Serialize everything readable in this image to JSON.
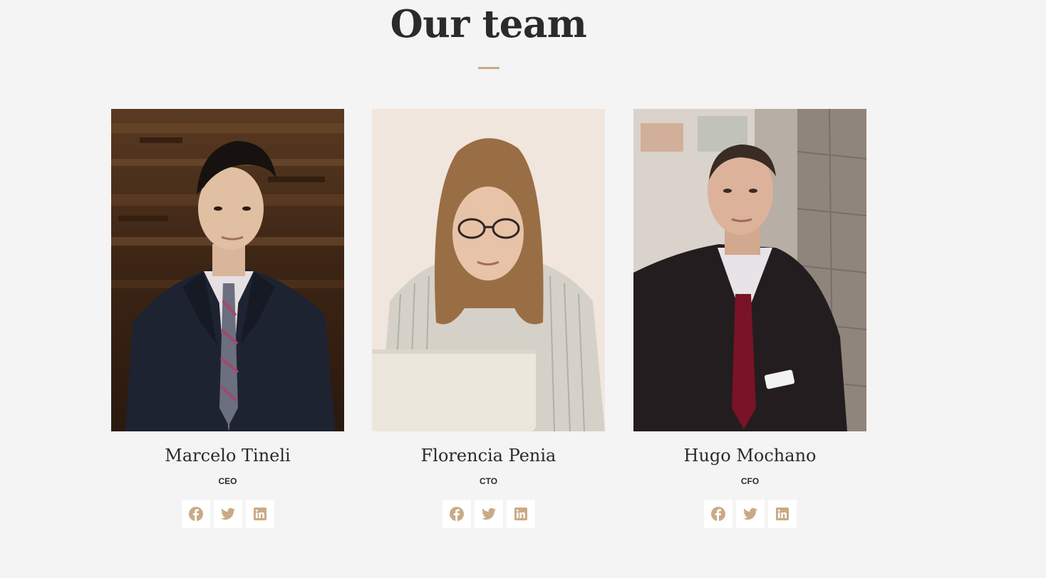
{
  "section": {
    "title": "Our team",
    "accent_color": "#c9aa85"
  },
  "members": [
    {
      "name": "Marcelo Tineli",
      "role": "CEO",
      "photo": "man-in-navy-suit-plaid-tie-wood-background"
    },
    {
      "name": "Florencia Penia",
      "role": "CTO",
      "photo": "woman-with-glasses-striped-shirt-laptop"
    },
    {
      "name": "Hugo Mochano",
      "role": "CFO",
      "photo": "man-in-black-suit-red-tie-stone-wall"
    }
  ],
  "social_icons": [
    "facebook-icon",
    "twitter-icon",
    "linkedin-icon"
  ]
}
